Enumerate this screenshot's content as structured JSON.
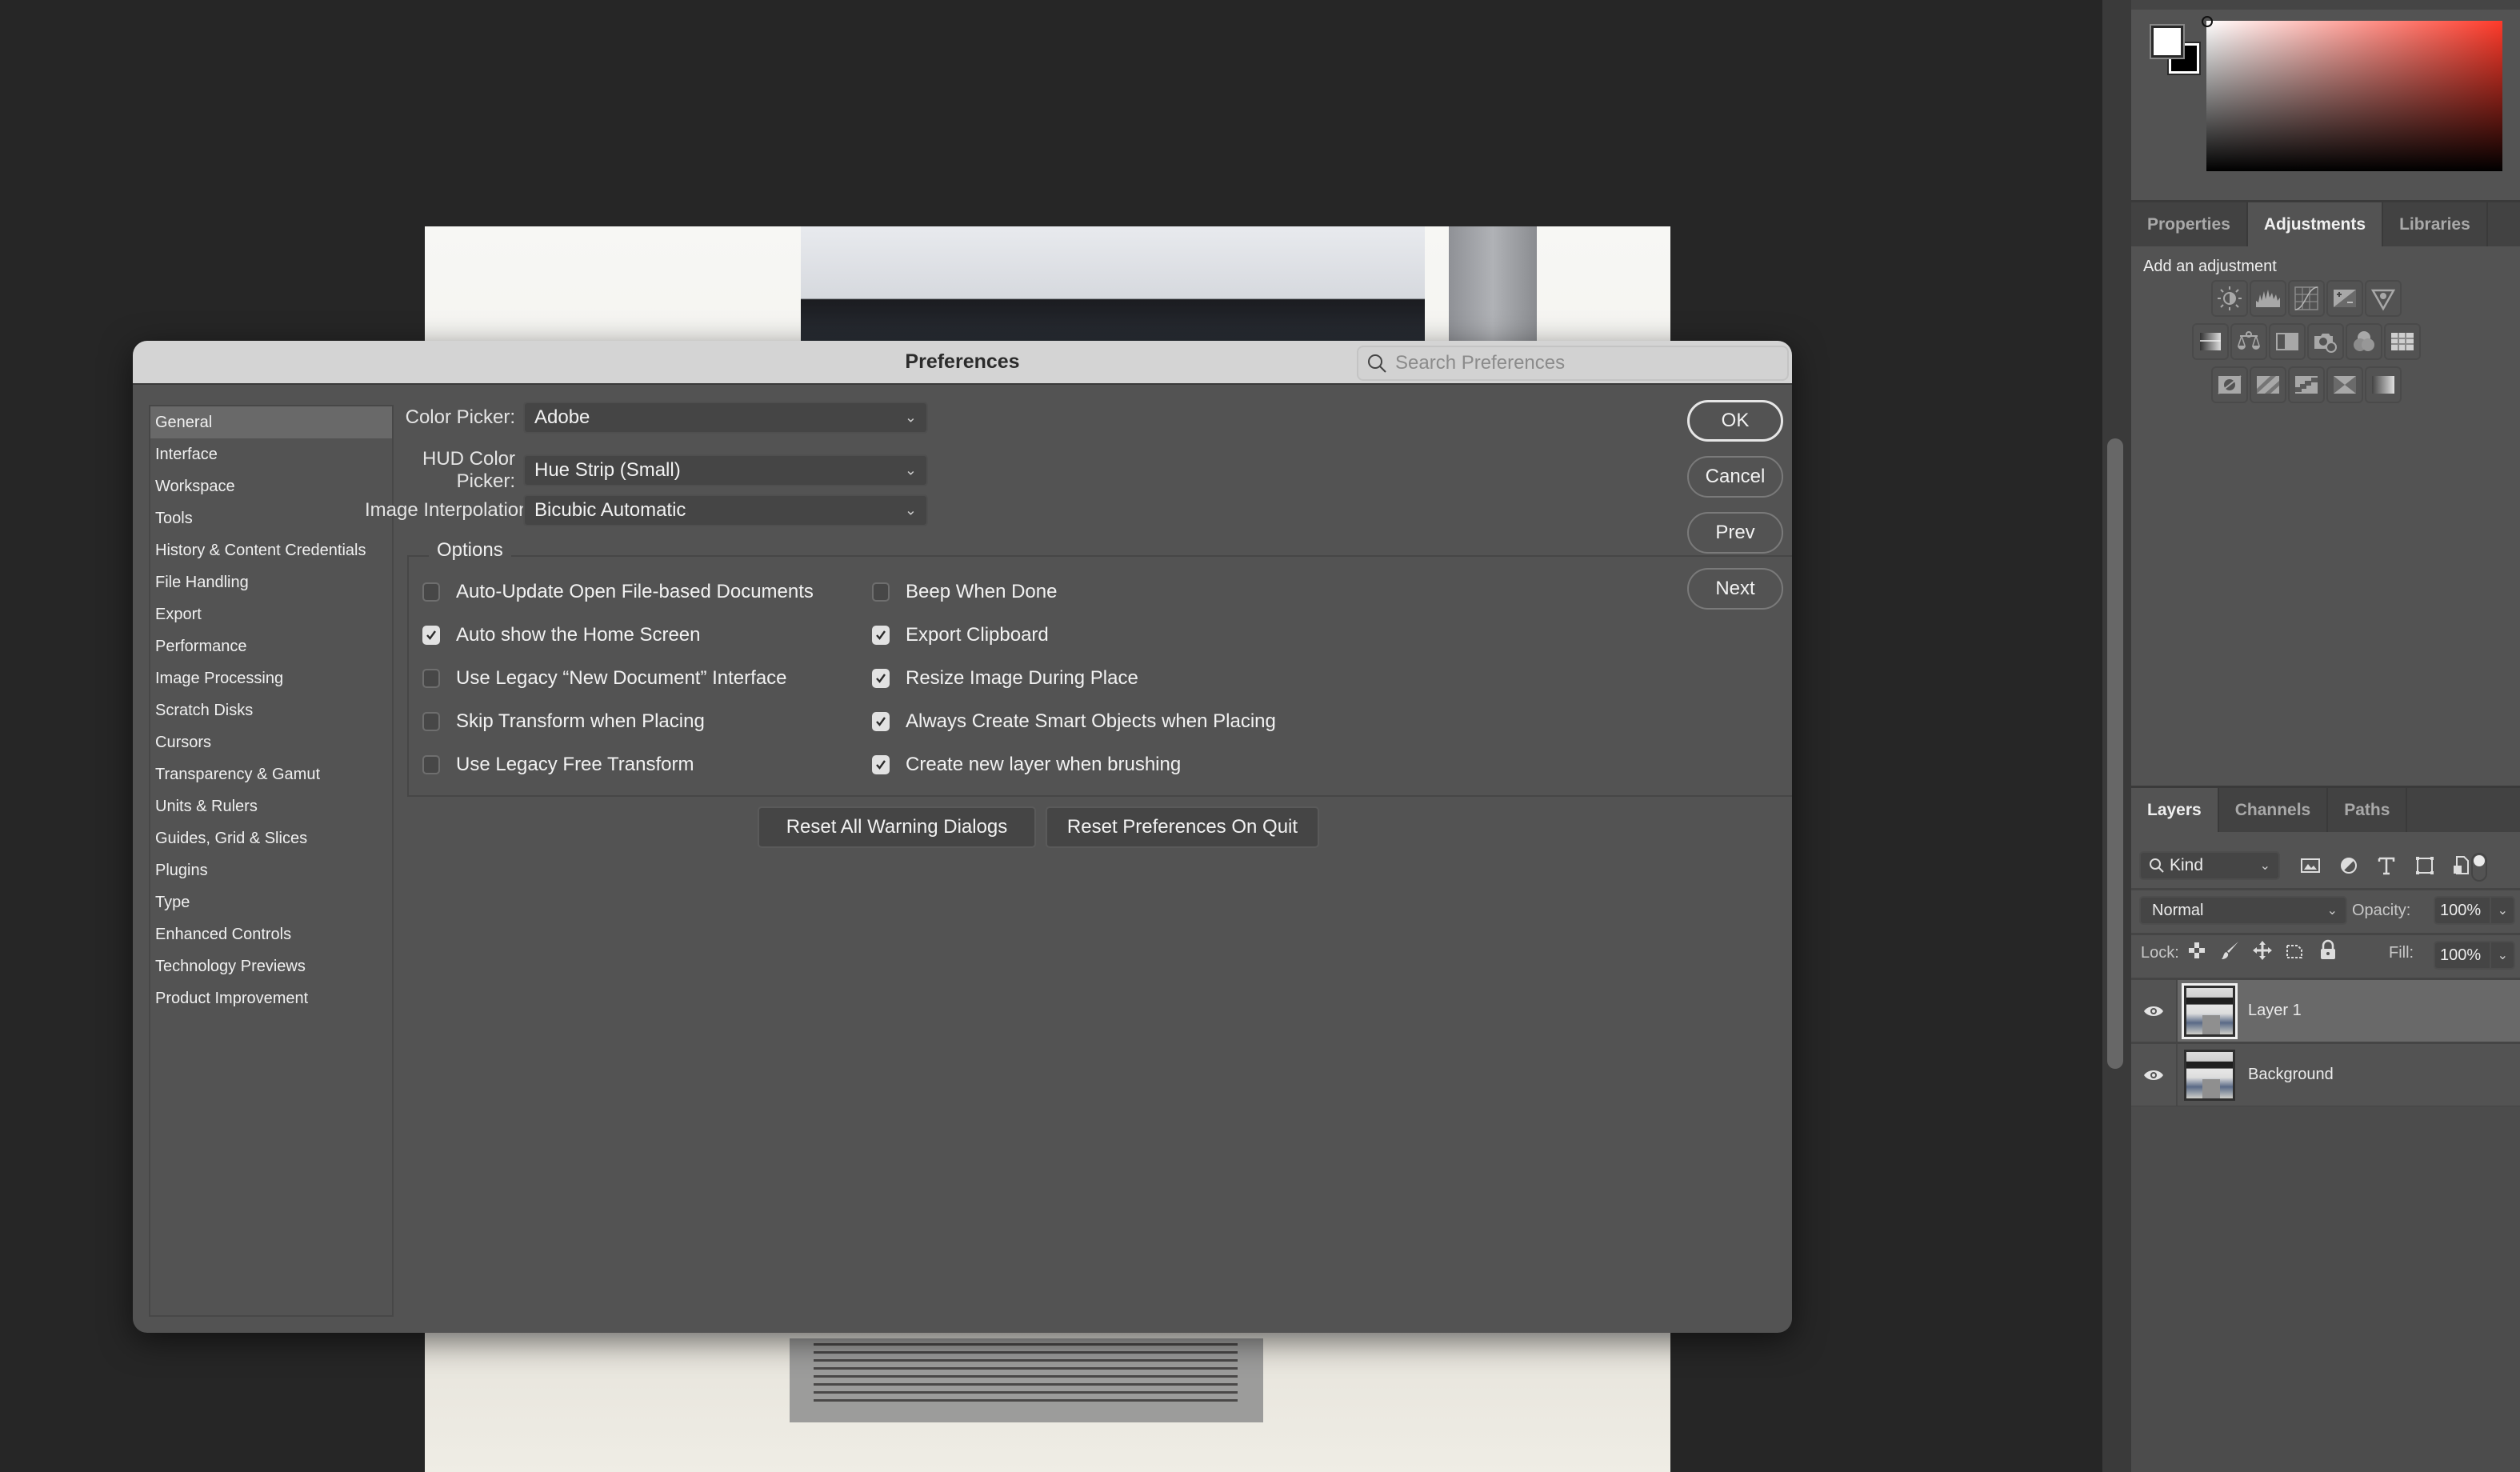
{
  "dialog": {
    "title": "Preferences",
    "search": {
      "placeholder": "Search Preferences",
      "value": ""
    },
    "nav": {
      "active": "General",
      "items": [
        "General",
        "Interface",
        "Workspace",
        "Tools",
        "History & Content Credentials",
        "File Handling",
        "Export",
        "Performance",
        "Image Processing",
        "Scratch Disks",
        "Cursors",
        "Transparency & Gamut",
        "Units & Rulers",
        "Guides, Grid & Slices",
        "Plugins",
        "Type",
        "Enhanced Controls",
        "Technology Previews",
        "Product Improvement"
      ]
    },
    "fields": {
      "color_picker": {
        "label": "Color Picker:",
        "value": "Adobe"
      },
      "hud_color_picker": {
        "label": "HUD Color Picker:",
        "value": "Hue Strip (Small)"
      },
      "image_interpolation": {
        "label": "Image Interpolation:",
        "value": "Bicubic Automatic"
      }
    },
    "options": {
      "legend": "Options",
      "left": [
        {
          "label": "Auto-Update Open File-based Documents",
          "checked": false
        },
        {
          "label": "Auto show the Home Screen",
          "checked": true
        },
        {
          "label": "Use Legacy “New Document” Interface",
          "checked": false
        },
        {
          "label": "Skip Transform when Placing",
          "checked": false
        },
        {
          "label": "Use Legacy Free Transform",
          "checked": false
        }
      ],
      "right": [
        {
          "label": "Beep When Done",
          "checked": false
        },
        {
          "label": "Export Clipboard",
          "checked": true
        },
        {
          "label": "Resize Image During Place",
          "checked": true
        },
        {
          "label": "Always Create Smart Objects when Placing",
          "checked": true
        },
        {
          "label": "Create new layer when brushing",
          "checked": true
        }
      ]
    },
    "buttons": {
      "reset_warnings": "Reset All Warning Dialogs",
      "reset_prefs": "Reset Preferences On Quit",
      "ok": "OK",
      "cancel": "Cancel",
      "prev": "Prev",
      "next": "Next"
    }
  },
  "color_panel": {
    "foreground": "#ffffff",
    "background": "#000000",
    "hue": "#ff3a2a"
  },
  "adjustments_panel": {
    "tabs": [
      "Properties",
      "Adjustments",
      "Libraries"
    ],
    "active_tab": "Adjustments",
    "title": "Add an adjustment",
    "icons": [
      [
        "brightness-contrast",
        "levels",
        "curves",
        "exposure",
        "vibrance"
      ],
      [
        "hue-saturation",
        "color-balance",
        "black-white",
        "photo-filter",
        "channel-mixer",
        "color-lookup"
      ],
      [
        "invert",
        "posterize",
        "threshold",
        "selective-color",
        "gradient-map"
      ]
    ]
  },
  "layers_panel": {
    "tabs": [
      "Layers",
      "Channels",
      "Paths"
    ],
    "active_tab": "Layers",
    "filter": {
      "value": "Kind"
    },
    "blend_mode": "Normal",
    "opacity": {
      "label": "Opacity:",
      "value": "100%"
    },
    "lock": {
      "label": "Lock:"
    },
    "fill": {
      "label": "Fill:",
      "value": "100%"
    },
    "layers": [
      {
        "name": "Layer 1",
        "visible": true,
        "selected": true
      },
      {
        "name": "Background",
        "visible": true,
        "selected": false
      }
    ]
  }
}
